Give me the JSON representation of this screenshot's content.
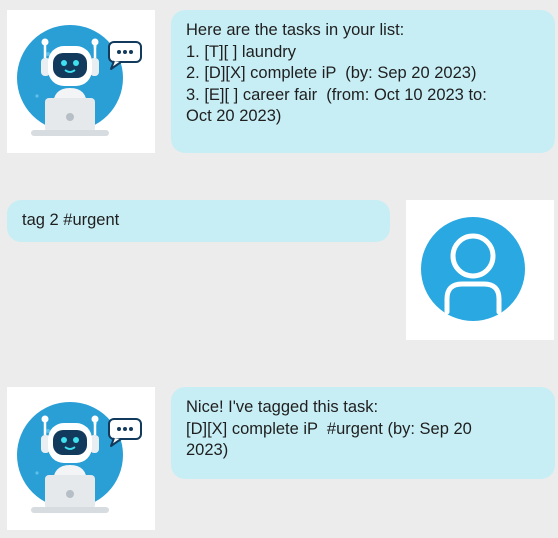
{
  "messages": [
    {
      "sender": "bot",
      "avatar_icon": "robot-icon",
      "lines": [
        "Here are the tasks in your list:",
        "1. [T][ ] laundry",
        "2. [D][X] complete iP  (by: Sep 20 2023)",
        "3. [E][ ] career fair  (from: Oct 10 2023 to:",
        "Oct 20 2023)"
      ]
    },
    {
      "sender": "user",
      "avatar_icon": "user-icon",
      "lines": [
        "tag 2 #urgent"
      ]
    },
    {
      "sender": "bot",
      "avatar_icon": "robot-icon",
      "lines": [
        "Nice! I've tagged this task:",
        "[D][X] complete iP  #urgent (by: Sep 20",
        "2023)"
      ]
    }
  ],
  "colors": {
    "background": "#ececec",
    "bubble": "#c7eef5",
    "avatar_circle": "#2aa8e0",
    "robot_face": "#123a5c",
    "robot_eyes": "#3fe0f0"
  }
}
